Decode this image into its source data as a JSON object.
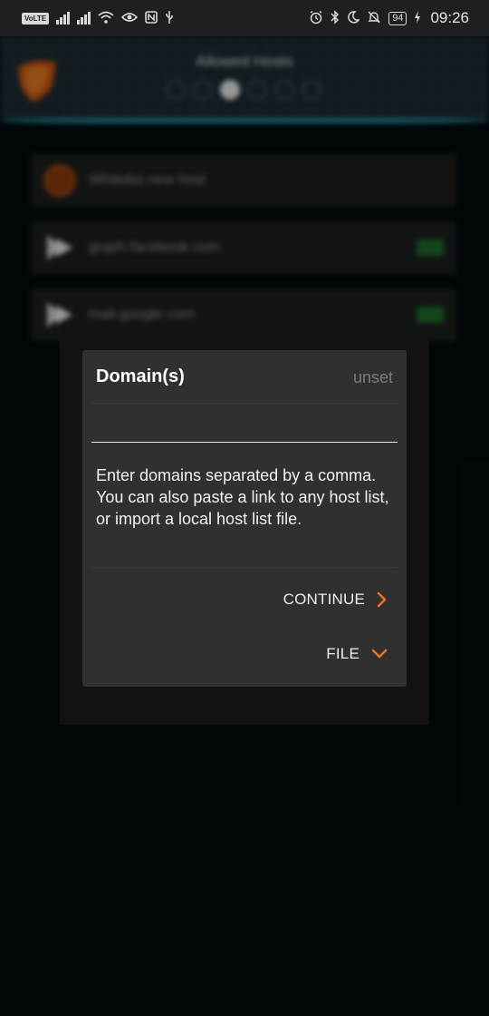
{
  "status_bar": {
    "left_icons": [
      "volte-icon",
      "signal-icon",
      "signal-icon",
      "wifi-icon",
      "eye-icon",
      "nfc-icon",
      "usb-icon"
    ],
    "volte_label": "VoLTE",
    "battery": "94",
    "time": "09:26"
  },
  "background": {
    "header_title": "Allowed Hosts",
    "host_items": [
      {
        "label": "Whitelist new host"
      },
      {
        "label": "graph.facebook.com",
        "toggle": "On"
      },
      {
        "label": "mail.google.com",
        "toggle": "On"
      }
    ]
  },
  "dialog": {
    "title": "Domain(s)",
    "value": "unset",
    "input_value": "",
    "help_text": "Enter domains separated by a comma. You can also paste a link to any host list, or import a local host list file.",
    "continue_label": "CONTINUE",
    "file_label": "FILE"
  },
  "colors": {
    "accent": "#f07021",
    "dialog_bg": "#303030",
    "status_bar_bg": "#1d2022",
    "page_bg": "#030b0e"
  }
}
